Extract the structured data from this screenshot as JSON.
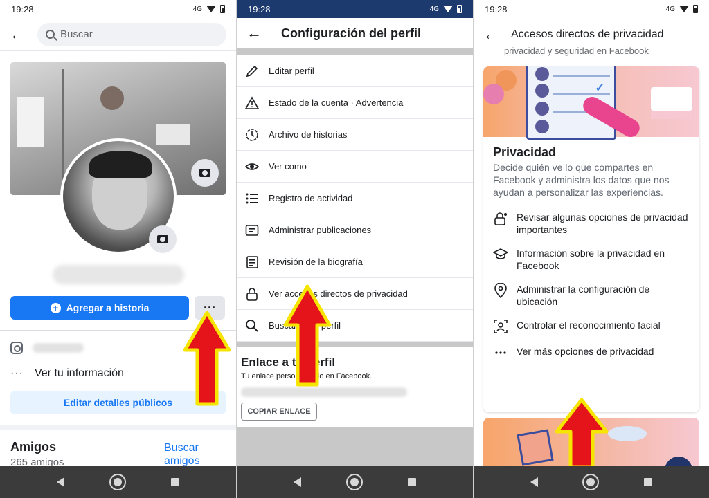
{
  "status_time": "19:28",
  "status_network": "4G",
  "panel1": {
    "search_placeholder": "Buscar",
    "add_story_label": "Agregar a historia",
    "more_label": "···",
    "see_info_label": "Ver tu información",
    "edit_public_label": "Editar detalles públicos",
    "friends_title": "Amigos",
    "friends_count": "265 amigos",
    "find_friends_label": "Buscar amigos"
  },
  "panel2": {
    "title": "Configuración del perfil",
    "menu": [
      {
        "label": "Editar perfil",
        "icon": "pencil-icon"
      },
      {
        "label": "Estado de la cuenta · Advertencia",
        "icon": "warning-icon"
      },
      {
        "label": "Archivo de historias",
        "icon": "history-icon"
      },
      {
        "label": "Ver como",
        "icon": "eye-icon"
      },
      {
        "label": "Registro de actividad",
        "icon": "list-icon"
      },
      {
        "label": "Administrar publicaciones",
        "icon": "posts-icon"
      },
      {
        "label": "Revisión de la biografía",
        "icon": "review-icon"
      },
      {
        "label": "Ver accesos directos de privacidad",
        "icon": "lock-icon"
      },
      {
        "label": "Buscar en el perfil",
        "icon": "search-icon"
      }
    ],
    "link_title": "Enlace a tu perfil",
    "link_desc": "Tu enlace personalizado en Facebook.",
    "copy_link_label": "COPIAR ENLACE"
  },
  "panel3": {
    "title": "Accesos directos de privacidad",
    "clipped_text": "privacidad y seguridad en Facebook",
    "privacy_title": "Privacidad",
    "privacy_desc": "Decide quién ve lo que compartes en Facebook y administra los datos que nos ayudan a personalizar las experiencias.",
    "options": [
      {
        "label": "Revisar algunas opciones de privacidad importantes",
        "icon": "lock-heart-icon"
      },
      {
        "label": "Información sobre la privacidad en Facebook",
        "icon": "graduation-cap-icon"
      },
      {
        "label": "Administrar la configuración de ubicación",
        "icon": "location-pin-icon"
      },
      {
        "label": "Controlar el reconocimiento facial",
        "icon": "face-scan-icon"
      },
      {
        "label": "Ver más opciones de privacidad",
        "icon": "more-dots-icon"
      }
    ]
  },
  "colors": {
    "facebook_blue": "#1877f2",
    "arrow_red": "#e5141b",
    "arrow_outline": "#f6e500"
  }
}
